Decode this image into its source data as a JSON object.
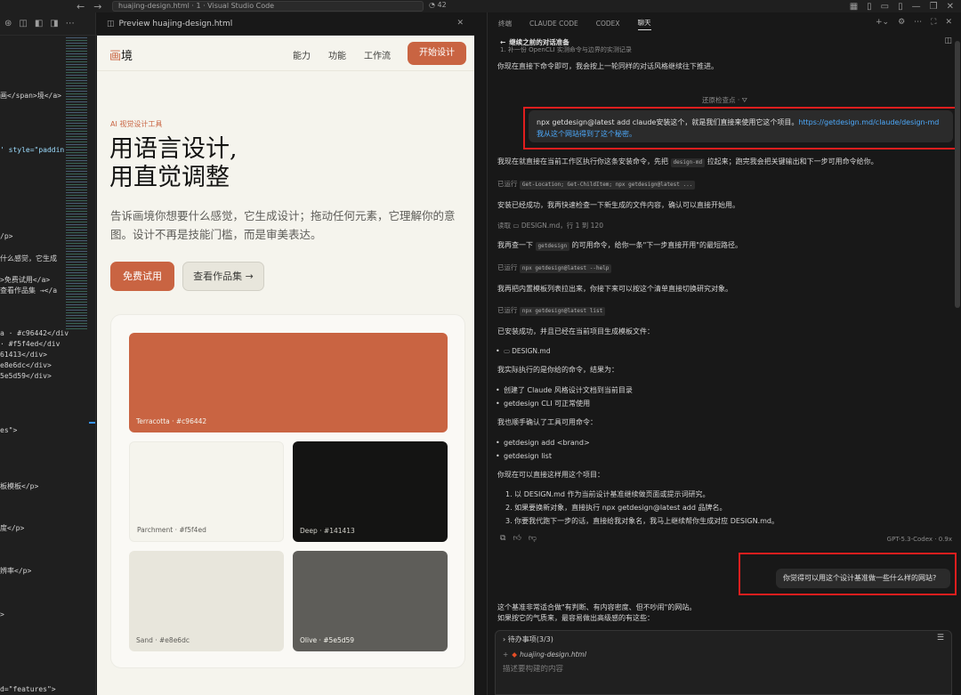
{
  "window": {
    "title": "huajing-design.html · 1 · Visual Studio Code",
    "badge": "42",
    "nav_back": "←",
    "nav_forward": "→"
  },
  "code_strip": {
    "lines": [
      "画</span>境</a>",
      "' style=\"paddin",
      "/p>",
      "什么感觉，它生成",
      ">免费试用</a>",
      "查看作品集 →</a",
      "a · #c96442</div",
      "· #f5f4ed</div",
      "61413</div>",
      "e8e6dc</div>",
      "5e5d59</div>",
      "es\">",
      "板模板</p>",
      "度</p>",
      "辨率</p>",
      ">",
      "d=\"features\">"
    ]
  },
  "preview": {
    "tab_label": "Preview huajing-design.html",
    "nav": {
      "logo_accent": "画",
      "logo_rest": "境",
      "links": [
        "能力",
        "功能",
        "工作流"
      ],
      "cta": "开始设计"
    },
    "hero": {
      "eyebrow": "AI 视觉设计工具",
      "title_line1": "用语言设计,",
      "title_line2": "用直觉调整",
      "subtitle": "告诉画境你想要什么感觉，它生成设计；拖动任何元素，它理解你的意图。设计不再是技能门槛，而是审美表达。",
      "primary_button": "免费试用",
      "secondary_button": "查看作品集 →"
    },
    "swatches": [
      {
        "label": "Terracotta · #c96442",
        "color": "#c96442",
        "text_color": "#f5f4ed"
      },
      {
        "label": "Parchment · #f5f4ed",
        "color": "#f5f4ed",
        "text_color": "#5e5d59"
      },
      {
        "label": "Deep · #141413",
        "color": "#141413",
        "text_color": "#d0cfc8"
      },
      {
        "label": "Sand · #e8e6dc",
        "color": "#e8e6dc",
        "text_color": "#5e5d59"
      },
      {
        "label": "Olive · #5e5d59",
        "color": "#5e5d59",
        "text_color": "#f5f4ed"
      }
    ]
  },
  "chat": {
    "tabs": [
      "终端",
      "CLAUDE CODE",
      "CODEX",
      "聊天"
    ],
    "conversation_title": "继续之前的对话准备",
    "partial_top": "1. 补一份 OpenCLI 实测命令与边界的实测记录",
    "intro": "你现在直接下命令即可，我会按上一轮同样的对话风格继续往下推进。",
    "checkpoint": "还原检查点",
    "user_message_1": "npx getdesign@latest add claude安装这个，就是我们直接来使用它这个项目。",
    "user_message_1_link": "https://getdesign.md/claude/design-md我从这个网站得到了这个秘密。",
    "reply_1_a": "我现在就直接在当前工作区执行你这条安装命令，先把",
    "reply_1_chip": "design-md",
    "reply_1_b": "拉起来；跑完我会把关键输出和下一步可用命令给你。",
    "ran_1_label": "已运行",
    "ran_1_cmd": "Get-Location; Get-ChildItem; npx getdesign@latest ...",
    "reply_2": "安装已经成功，我再快速检查一下新生成的文件内容，确认可以直接开始用。",
    "read_label": "读取",
    "read_file": "DESIGN.md",
    "read_range": "，行 1 到 120",
    "reply_3_a": "我再查一下",
    "reply_3_chip": "getdesign",
    "reply_3_b": "的可用命令，给你一条\"下一步直接开用\"的最短路径。",
    "ran_2_label": "已运行",
    "ran_2_cmd": "npx getdesign@latest --help",
    "reply_4": "我再把内置模板列表拉出来，你接下来可以按这个清单直接切换研究对象。",
    "ran_3_label": "已运行",
    "ran_3_cmd": "npx getdesign@latest list",
    "reply_5": "已安装成功，并且已经在当前项目生成模板文件：",
    "generated_file": "DESIGN.md",
    "reply_6": "我实际执行的是你给的命令，结果为：",
    "result_items": [
      "创建了 Claude 风格设计文档到当前目录",
      "getdesign CLI 可正常使用"
    ],
    "reply_7": "我也顺手确认了工具可用命令：",
    "command_items": [
      "getdesign add <brand>",
      "getdesign list"
    ],
    "reply_8": "你现在可以直接这样用这个项目：",
    "usage_items": [
      "1. 以 DESIGN.md 作为当前设计基准继续做页面或提示词研究。",
      "2. 如果要换新对象，直接执行 npx getdesign@latest add 品牌名。",
      "3. 你要我代跑下一步的话，直接给我对象名，我马上继续帮你生成对应 DESIGN.md。"
    ],
    "action_icons": [
      "copy-icon",
      "thumbs-up-icon",
      "thumbs-down-icon"
    ],
    "model": "GPT-5.3-Codex · 0.9x",
    "user_message_2": "你觉得可以用这个设计基准做一些什么样的网站?",
    "reply_9_a": "这个基准非常适合做\"有判断、有内容密度、但不吵闹\"的网站。",
    "reply_9_b": "如果按它的气质来，最容易做出高级感的有这些：",
    "composer": {
      "todo": "待办事项(3/3)",
      "attachment": "huajing-design.html",
      "placeholder": "描述要构建的内容"
    }
  }
}
